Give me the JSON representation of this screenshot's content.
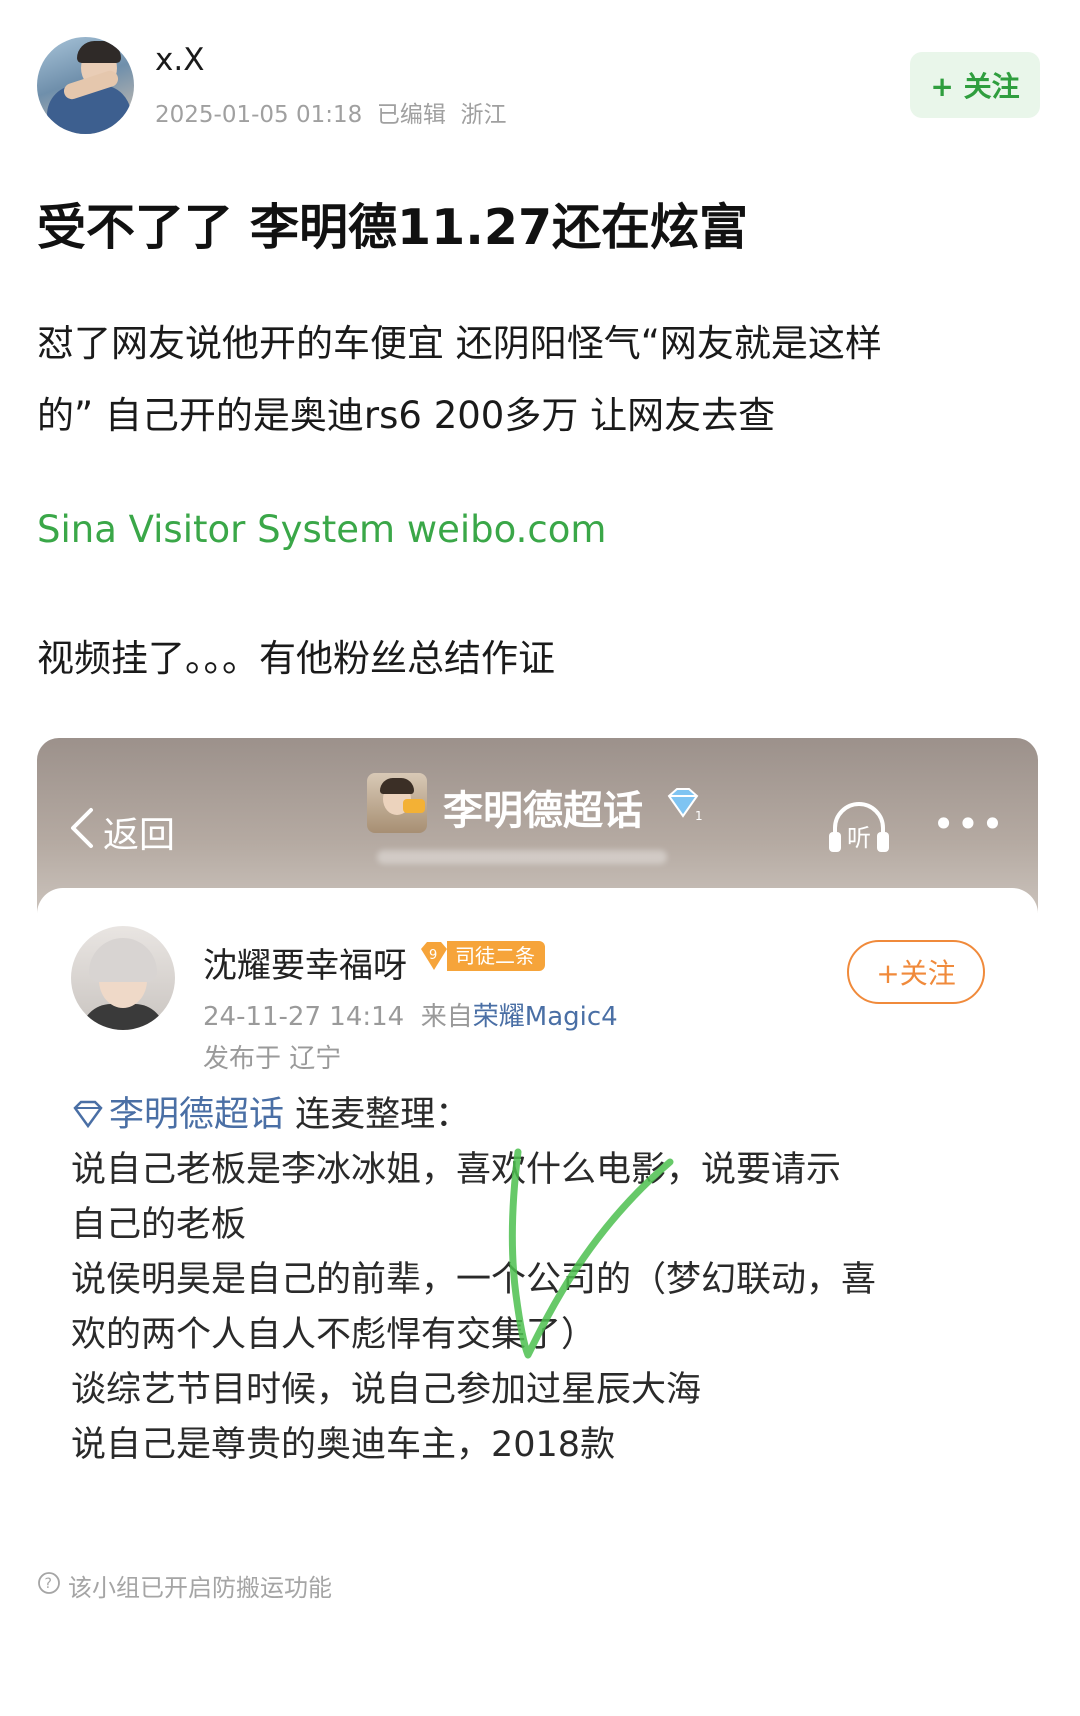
{
  "post": {
    "author": "x.X",
    "meta": "2025-01-05 01:18  已编辑  浙江",
    "follow_label": "+ 关注",
    "title": "受不了了 李明德11.27还在炫富",
    "body_lines": [
      "怼了网友说他开的车便宜 还阴阳怪气“网友就是这样",
      "的” 自己开的是奥迪rs6 200多万 让网友去查"
    ],
    "link_text": "Sina Visitor System weibo.com",
    "note": "视频挂了。。。有他粉丝总结作证"
  },
  "screenshot": {
    "back_label": "返回",
    "topic_title": "李明德超话",
    "listen_label": "听",
    "more_label": "•••",
    "user": "沈耀要幸福呀",
    "level": "9",
    "badge": "司徒二条",
    "time": "24-11-27 14:14",
    "from_label": "来自",
    "device": "荣耀Magic4",
    "location": "发布于 辽宁",
    "follow_label": "+关注",
    "topic_link": "李明德超话",
    "content_lines": [
      " 连麦整理：",
      "说自己老板是李冰冰姐，喜欢什么电影，说要请示",
      "自己的老板",
      "说侯明昊是自己的前辈，一个公司的（梦幻联动，喜",
      "欢的两个人自人不彪悍有交集了）",
      "谈综艺节目时候，说自己参加过星辰大海",
      "说自己是尊贵的奥迪车主，2018款"
    ]
  },
  "footer": {
    "notice": "该小组已开启防搬运功能"
  },
  "colors": {
    "link_green": "#3aa748",
    "follow_green_bg": "#e9f6ea",
    "topic_blue": "#4a6fa5",
    "follow_orange": "#f08a3b",
    "badge_orange": "#f6a43a",
    "check_green": "#4cc04f"
  }
}
